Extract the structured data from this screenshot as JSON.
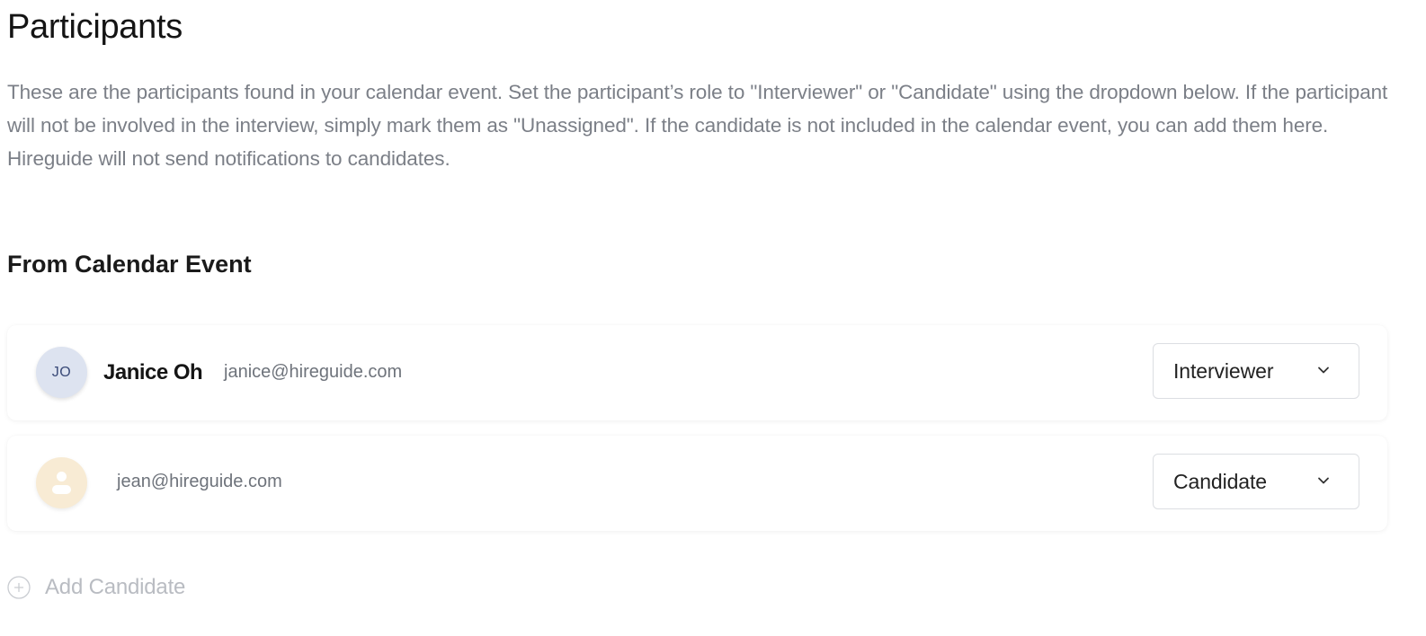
{
  "page": {
    "title": "Participants",
    "description": "These are the participants found in your calendar event. Set the participant’s role to \"Interviewer\" or \"Candidate\" using the dropdown below. If the participant will not be involved in the interview, simply mark them as \"Unassigned\". If the candidate is not included in the calendar event, you can add them here. Hireguide will not send notifications to candidates."
  },
  "section": {
    "title": "From Calendar Event"
  },
  "participants": [
    {
      "initials": "JO",
      "name": "Janice Oh",
      "email": "janice@hireguide.com",
      "role": "Interviewer",
      "avatar_icon": "initials-avatar"
    },
    {
      "initials": "",
      "name": "",
      "email": "jean@hireguide.com",
      "role": "Candidate",
      "avatar_icon": "person-icon"
    }
  ],
  "add_candidate": {
    "label": "Add Candidate",
    "icon": "plus-circle-icon"
  },
  "colors": {
    "initials_avatar_bg": "#dde3f0",
    "person_avatar_bg": "#f8ebd4",
    "muted_text": "#7b7f87",
    "disabled_text": "#b9bcc2"
  }
}
